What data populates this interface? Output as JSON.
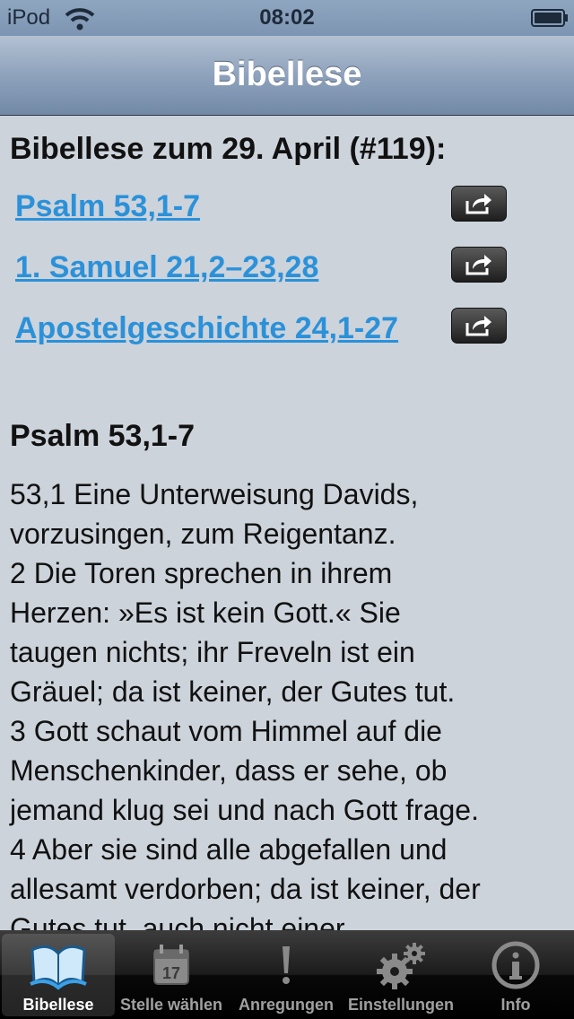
{
  "status_bar": {
    "carrier": "iPod",
    "time": "08:02",
    "wifi_icon": "wifi-icon",
    "battery_icon": "battery-icon"
  },
  "nav": {
    "title": "Bibellese"
  },
  "reading": {
    "heading": "Bibellese zum 29. April (#119):",
    "references": [
      {
        "label": "Psalm 53,1-7",
        "share_icon": "share-icon"
      },
      {
        "label": "1. Samuel 21,2–23,28",
        "share_icon": "share-icon"
      },
      {
        "label": "Apostelgeschichte 24,1-27",
        "share_icon": "share-icon"
      }
    ]
  },
  "passage": {
    "title": "Psalm 53,1-7",
    "lines": [
      "53,1 Eine Unterweisung Davids,",
      "vorzusingen, zum Reigentanz.",
      "2 Die Toren sprechen in ihrem",
      "Herzen: »Es ist kein Gott.« Sie",
      "taugen nichts; ihr Freveln ist ein",
      "Gräuel; da ist keiner, der Gutes tut.",
      "3 Gott schaut vom Himmel auf die",
      "Menschenkinder, dass er sehe, ob",
      "jemand klug sei und nach Gott frage.",
      "4 Aber sie sind alle abgefallen und",
      "allesamt verdorben; da ist keiner, der",
      "Gutes tut, auch nicht einer."
    ]
  },
  "tab_bar": {
    "selected": "Bibellese",
    "tabs": [
      {
        "label": "Bibellese",
        "icon": "book-icon"
      },
      {
        "label": "Stelle wählen",
        "icon": "calendar-icon",
        "calendar_day": "17"
      },
      {
        "label": "Anregungen",
        "icon": "exclamation-icon"
      },
      {
        "label": "Einstellungen",
        "icon": "gears-icon"
      },
      {
        "label": "Info",
        "icon": "info-icon"
      }
    ]
  },
  "colors": {
    "link": "#2b91d9",
    "nav_bar": "#8ea2bc",
    "background": "#ccd3db",
    "tab_bar": "#1b1b1b"
  }
}
